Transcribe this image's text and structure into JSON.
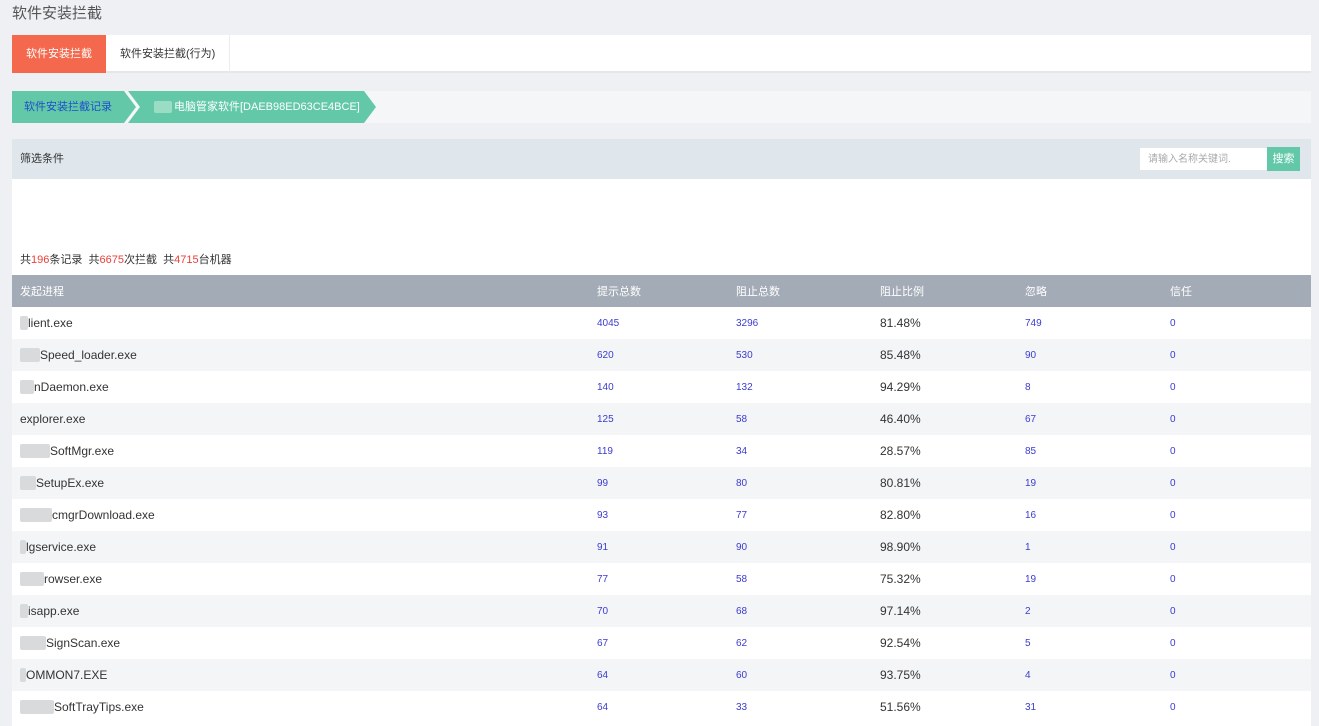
{
  "page": {
    "title": "软件安装拦截"
  },
  "tabs": [
    {
      "label": "软件安装拦截",
      "active": true
    },
    {
      "label": "软件安装拦截(行为)",
      "active": false
    }
  ],
  "breadcrumb": [
    {
      "label": "软件安装拦截记录"
    },
    {
      "label": "电脑管家软件[DAEB98ED63CE4BCE]"
    }
  ],
  "filter": {
    "title": "筛选条件",
    "search_placeholder": "请输入名称关键词.",
    "search_label": "搜索"
  },
  "summary": {
    "prefix1": "共",
    "records": "196",
    "suffix1": "条记录",
    "prefix2": "共",
    "blocks": "6675",
    "suffix2": "次拦截",
    "prefix3": "共",
    "machines": "4715",
    "suffix3": "台机器"
  },
  "table": {
    "columns": [
      "发起进程",
      "提示总数",
      "阻止总数",
      "阻止比例",
      "忽略",
      "信任"
    ],
    "rows": [
      {
        "process": "lient.exe",
        "prompts": "4045",
        "blocked": "3296",
        "ratio": "81.48%",
        "ignored": "749",
        "trusted": "0"
      },
      {
        "process": "Speed_loader.exe",
        "prompts": "620",
        "blocked": "530",
        "ratio": "85.48%",
        "ignored": "90",
        "trusted": "0"
      },
      {
        "process": "nDaemon.exe",
        "prompts": "140",
        "blocked": "132",
        "ratio": "94.29%",
        "ignored": "8",
        "trusted": "0"
      },
      {
        "process": "explorer.exe",
        "prompts": "125",
        "blocked": "58",
        "ratio": "46.40%",
        "ignored": "67",
        "trusted": "0"
      },
      {
        "process": "SoftMgr.exe",
        "prompts": "119",
        "blocked": "34",
        "ratio": "28.57%",
        "ignored": "85",
        "trusted": "0"
      },
      {
        "process": "SetupEx.exe",
        "prompts": "99",
        "blocked": "80",
        "ratio": "80.81%",
        "ignored": "19",
        "trusted": "0"
      },
      {
        "process": "cmgrDownload.exe",
        "prompts": "93",
        "blocked": "77",
        "ratio": "82.80%",
        "ignored": "16",
        "trusted": "0"
      },
      {
        "process": "lgservice.exe",
        "prompts": "91",
        "blocked": "90",
        "ratio": "98.90%",
        "ignored": "1",
        "trusted": "0"
      },
      {
        "process": "rowser.exe",
        "prompts": "77",
        "blocked": "58",
        "ratio": "75.32%",
        "ignored": "19",
        "trusted": "0"
      },
      {
        "process": "isapp.exe",
        "prompts": "70",
        "blocked": "68",
        "ratio": "97.14%",
        "ignored": "2",
        "trusted": "0"
      },
      {
        "process": "SignScan.exe",
        "prompts": "67",
        "blocked": "62",
        "ratio": "92.54%",
        "ignored": "5",
        "trusted": "0"
      },
      {
        "process": "OMMON7.EXE",
        "prompts": "64",
        "blocked": "60",
        "ratio": "93.75%",
        "ignored": "4",
        "trusted": "0"
      },
      {
        "process": "SoftTrayTips.exe",
        "prompts": "64",
        "blocked": "33",
        "ratio": "51.56%",
        "ignored": "31",
        "trusted": "0"
      }
    ]
  },
  "colors": {
    "tab_active": "#f4694d",
    "accent_green": "#62c8a8",
    "table_header": "#a3abb6",
    "link": "#3b3bd1",
    "highlight_number": "#e8403a"
  }
}
